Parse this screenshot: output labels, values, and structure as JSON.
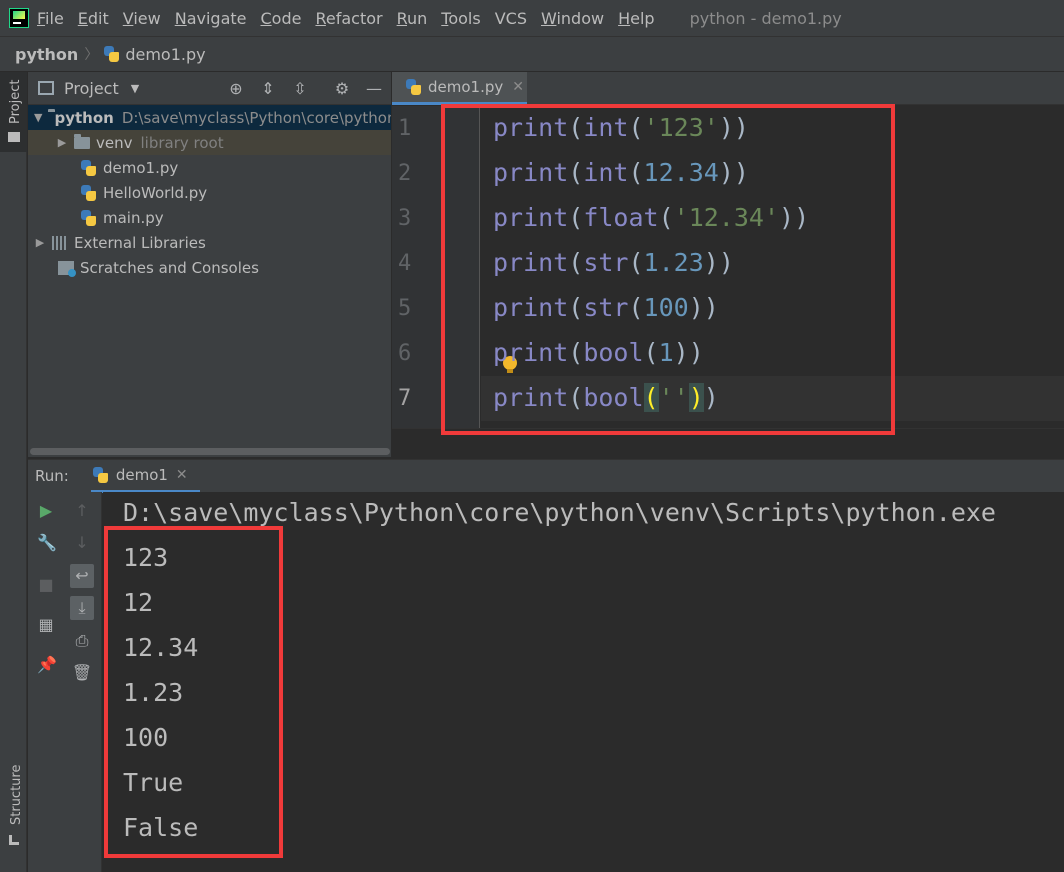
{
  "menubar": {
    "items": [
      {
        "mn": "F",
        "rest": "ile"
      },
      {
        "mn": "E",
        "rest": "dit"
      },
      {
        "mn": "V",
        "rest": "iew"
      },
      {
        "mn": "N",
        "rest": "avigate"
      },
      {
        "mn": "C",
        "rest": "ode"
      },
      {
        "mn": "R",
        "rest": "efactor"
      },
      {
        "mn": "R",
        "rest": "un"
      },
      {
        "mn": "T",
        "rest": "ools"
      },
      {
        "mn": "",
        "rest": "VCS"
      },
      {
        "mn": "W",
        "rest": "indow"
      },
      {
        "mn": "H",
        "rest": "elp"
      }
    ],
    "title": "python - demo1.py"
  },
  "breadcrumb": {
    "root": "python",
    "file": "demo1.py"
  },
  "side_tabs": {
    "project": "Project",
    "structure": "Structure"
  },
  "project_panel": {
    "title": "Project",
    "tree": {
      "root_name": "python",
      "root_path": "D:\\save\\myclass\\Python\\core\\python",
      "venv_name": "venv",
      "venv_hint": "library root",
      "files": [
        "demo1.py",
        "HelloWorld.py",
        "main.py"
      ],
      "external": "External Libraries",
      "scratches": "Scratches and Consoles"
    }
  },
  "editor": {
    "tab": "demo1.py",
    "line_numbers": [
      "1",
      "2",
      "3",
      "4",
      "5",
      "6",
      "7"
    ],
    "lines": [
      {
        "fn": "print",
        "conv": "int",
        "arg": "'123'",
        "argtype": "st"
      },
      {
        "fn": "print",
        "conv": "int",
        "arg": "12.34",
        "argtype": "nm"
      },
      {
        "fn": "print",
        "conv": "float",
        "arg": "'12.34'",
        "argtype": "st"
      },
      {
        "fn": "print",
        "conv": "str",
        "arg": "1.23",
        "argtype": "nm"
      },
      {
        "fn": "print",
        "conv": "str",
        "arg": "100",
        "argtype": "nm"
      },
      {
        "fn": "print",
        "conv": "bool",
        "arg": "1",
        "argtype": "nm"
      },
      {
        "fn": "print",
        "conv": "bool",
        "arg": "''",
        "argtype": "st"
      }
    ]
  },
  "run": {
    "label": "Run:",
    "tab": "demo1",
    "command": "D:\\save\\myclass\\Python\\core\\python\\venv\\Scripts\\python.exe",
    "output": [
      "123",
      "12",
      "12.34",
      "1.23",
      "100",
      "True",
      "False"
    ]
  },
  "colors": {
    "highlight_box": "#f03a3a",
    "accent": "#4a88c7"
  }
}
